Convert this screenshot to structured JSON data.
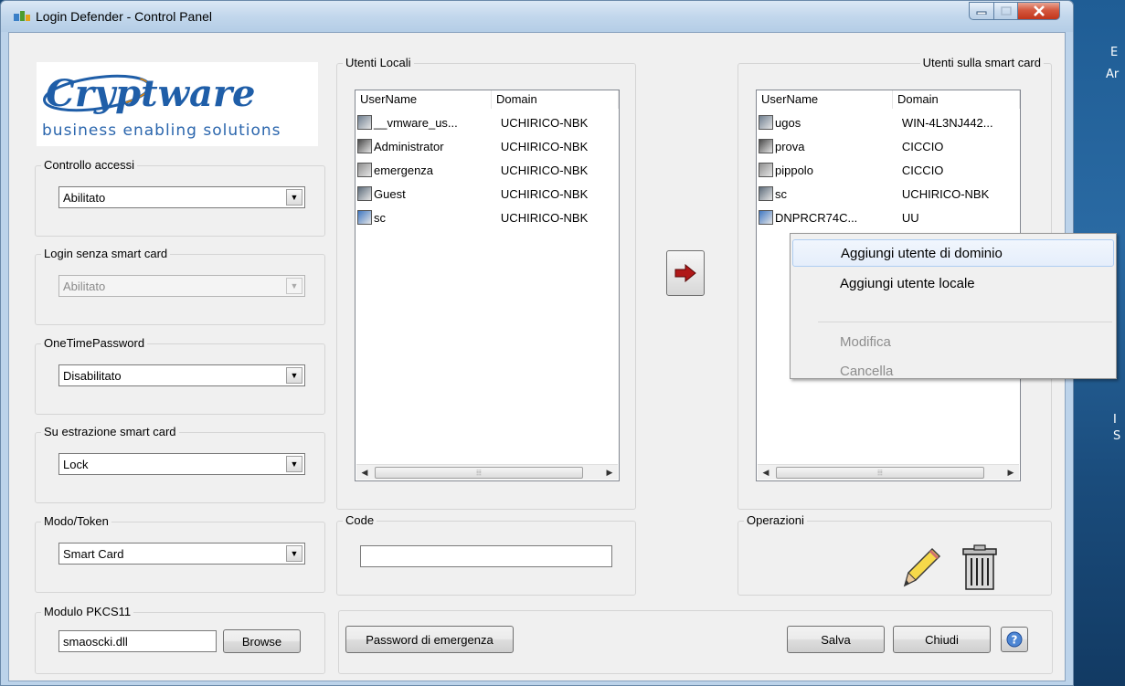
{
  "window": {
    "title": "Login Defender - Control Panel"
  },
  "logo": {
    "brand": "Cryptware",
    "tagline": "business enabling solutions"
  },
  "controllo_accessi": {
    "label": "Controllo accessi",
    "value": "Abilitato"
  },
  "login_senza_smartcard": {
    "label": "Login senza smart card",
    "value": "Abilitato"
  },
  "otp": {
    "label": "OneTimePassword",
    "value": "Disabilitato"
  },
  "estrazione": {
    "label": "Su estrazione smart card",
    "value": "Lock"
  },
  "modo_token": {
    "label": "Modo/Token",
    "value": "Smart Card"
  },
  "pkcs11": {
    "label": "Modulo PKCS11",
    "value": "smaoscki.dll",
    "browse_label": "Browse"
  },
  "utenti_locali": {
    "label": "Utenti Locali",
    "columns": [
      "UserName",
      "Domain"
    ],
    "rows": [
      {
        "user": "__vmware_us...",
        "domain": "UCHIRICO-NBK"
      },
      {
        "user": "Administrator",
        "domain": "UCHIRICO-NBK"
      },
      {
        "user": "emergenza",
        "domain": "UCHIRICO-NBK"
      },
      {
        "user": "Guest",
        "domain": "UCHIRICO-NBK"
      },
      {
        "user": "sc",
        "domain": "UCHIRICO-NBK"
      }
    ]
  },
  "utenti_smartcard": {
    "label": "Utenti sulla smart card",
    "columns": [
      "UserName",
      "Domain"
    ],
    "rows": [
      {
        "user": "ugos",
        "domain": "WIN-4L3NJ442..."
      },
      {
        "user": "prova",
        "domain": "CICCIO"
      },
      {
        "user": "pippolo",
        "domain": "CICCIO"
      },
      {
        "user": "sc",
        "domain": "UCHIRICO-NBK"
      },
      {
        "user": "DNPRCR74C...",
        "domain": "UU"
      }
    ]
  },
  "code": {
    "label": "Code",
    "value": ""
  },
  "operazioni": {
    "label": "Operazioni"
  },
  "bottom": {
    "password_emergenza": "Password di emergenza",
    "salva": "Salva",
    "chiudi": "Chiudi"
  },
  "context_menu": {
    "items": [
      {
        "label": "Aggiungi utente di dominio",
        "state": "hover"
      },
      {
        "label": "Aggiungi utente locale",
        "state": "normal"
      },
      {
        "label": "Modifica",
        "state": "disabled"
      },
      {
        "label": "Cancella",
        "state": "disabled"
      }
    ]
  },
  "desktop": {
    "text_a": "E",
    "text_b": "Ar",
    "text_c": "I",
    "text_d": "S"
  },
  "colors": {
    "accent": "#1f5ea8",
    "logo_orange": "#f08a00"
  }
}
